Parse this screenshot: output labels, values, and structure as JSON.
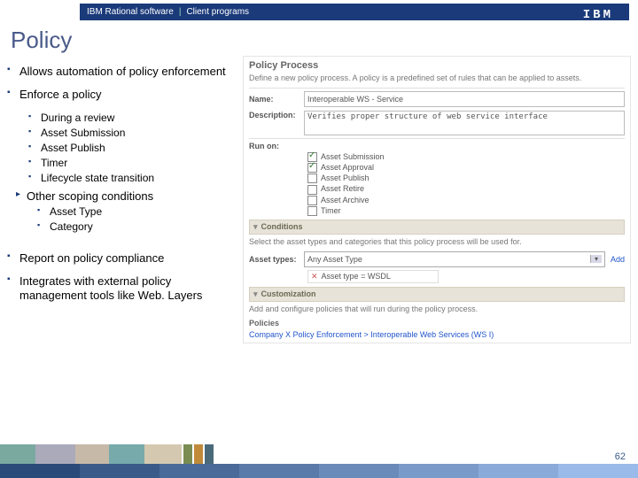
{
  "header": {
    "crumb1": "IBM Rational software",
    "crumb2": "Client programs",
    "logo": "IBM"
  },
  "title": "Policy",
  "bullets": {
    "b1": "Allows automation of policy enforcement",
    "b2": "Enforce a policy",
    "b2_subs": [
      "During a review",
      "Asset Submission",
      "Asset Publish",
      "Timer",
      "Lifecycle state transition"
    ],
    "other": "Other scoping conditions",
    "other_subs": [
      "Asset Type",
      "Category"
    ],
    "b3": "Report on policy compliance",
    "b4": "Integrates with external policy management tools like Web. Layers"
  },
  "panel": {
    "heading": "Policy Process",
    "desc": "Define a new policy process. A policy is a predefined set of rules that can be applied to assets.",
    "name_label": "Name:",
    "name_value": "Interoperable WS - Service",
    "desc_label": "Description:",
    "desc_value": "Verifies proper structure of web service interface",
    "runon_label": "Run on:",
    "runon_opts": [
      {
        "label": "Asset Submission",
        "checked": true
      },
      {
        "label": "Asset Approval",
        "checked": true
      },
      {
        "label": "Asset Publish",
        "checked": false
      },
      {
        "label": "Asset Retire",
        "checked": false
      },
      {
        "label": "Asset Archive",
        "checked": false
      },
      {
        "label": "Timer",
        "checked": false
      }
    ],
    "conditions": {
      "head": "Conditions",
      "desc": "Select the asset types and categories that this policy process will be used for.",
      "types_label": "Asset types:",
      "dropdown": "Any Asset Type",
      "add": "Add",
      "tag": "Asset type = WSDL"
    },
    "custom": {
      "head": "Customization",
      "desc": "Add and configure policies that will run during the policy process.",
      "pol_label": "Policies",
      "bc": "Company X Policy Enforcement > Interoperable Web Services (WS I)"
    }
  },
  "pagenum": "62"
}
